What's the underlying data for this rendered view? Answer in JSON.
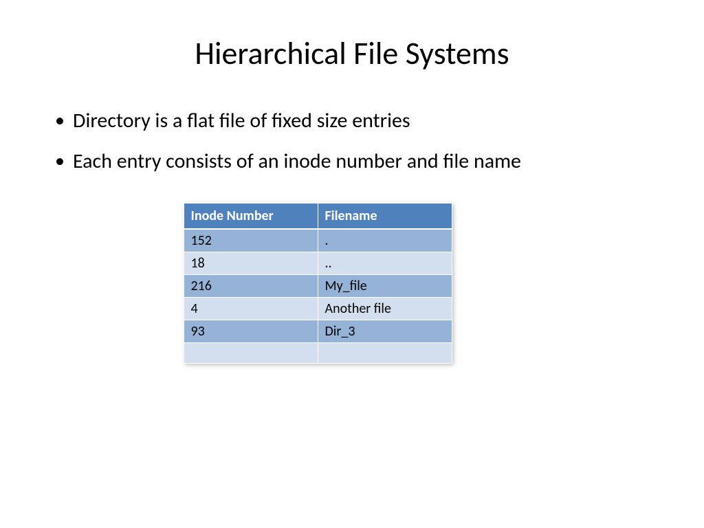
{
  "title": "Hierarchical File Systems",
  "bullets": [
    "Directory is a flat file of fixed size entries",
    "Each entry consists of an inode number and file name"
  ],
  "table": {
    "headers": [
      "Inode Number",
      "Filename"
    ],
    "rows": [
      {
        "inode": "152",
        "filename": "."
      },
      {
        "inode": "18",
        "filename": ".."
      },
      {
        "inode": "216",
        "filename": "My_file"
      },
      {
        "inode": "4",
        "filename": "Another file"
      },
      {
        "inode": "93",
        "filename": "Dir_3"
      },
      {
        "inode": "",
        "filename": ""
      }
    ]
  }
}
